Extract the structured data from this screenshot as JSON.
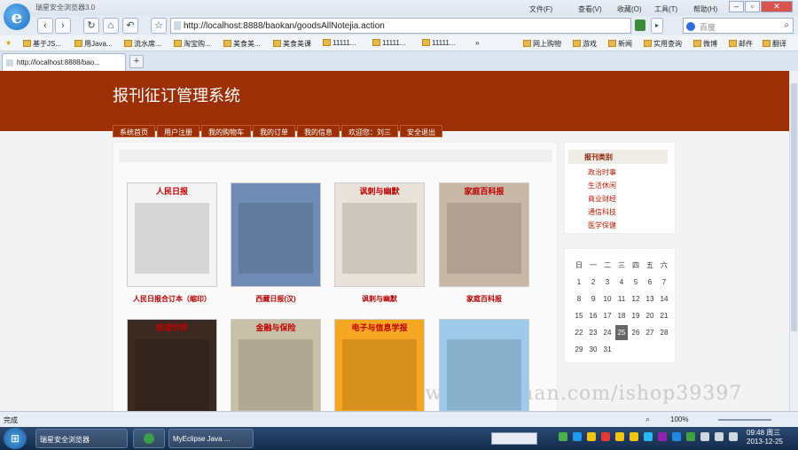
{
  "browser": {
    "app_title": "瑞星安全浏览器3.0",
    "menu": [
      "文件(F)",
      "查看(V)",
      "收藏(O)",
      "工具(T)",
      "帮助(H)"
    ],
    "address": "http://localhost:8888/baokan/goodsAllNotejia.action",
    "search_placeholder": "百度",
    "favorites": [
      "基于JS...",
      "用Java...",
      "流水席...",
      "淘宝购...",
      "美食美...",
      "美食美课",
      "11111...",
      "11111...",
      "11111..."
    ],
    "favorites_right": [
      "网上购物",
      "游戏",
      "新闻",
      "实用查询",
      "微博",
      "邮件",
      "翻译"
    ],
    "tab_label": "http://localhost:8888/bao...",
    "new_tab": "+",
    "status_text": "完成",
    "zoom": "100%"
  },
  "site": {
    "title": "报刊征订管理系统",
    "nav": [
      "系统首页",
      "用户注册",
      "我的购物车",
      "我的订单",
      "我的信息",
      "欢迎您：刘三",
      "安全退出"
    ]
  },
  "goods": [
    {
      "name": "人民日报合订本（缩印）",
      "cover_text": "人民日报",
      "cover_color": "#f4f4f4"
    },
    {
      "name": "西藏日报(汉)",
      "cover_text": "",
      "cover_color": "#6f8db4"
    },
    {
      "name": "讽刺与幽默",
      "cover_text": "讽刺与幽默",
      "cover_color": "#e9e2d8"
    },
    {
      "name": "家庭百科报",
      "cover_text": "家庭百科报",
      "cover_color": "#c9b7a8"
    },
    {
      "name": "",
      "cover_text": "经理世界",
      "cover_color": "#3a2a22"
    },
    {
      "name": "",
      "cover_text": "金融与保险",
      "cover_color": "#c8c0a8"
    },
    {
      "name": "",
      "cover_text": "电子与信息学报",
      "cover_color": "#f5a623"
    },
    {
      "name": "",
      "cover_text": "",
      "cover_color": "#9fc9e8"
    }
  ],
  "sidebar": {
    "category_title": "报刊类别",
    "categories": [
      "政治时事",
      "生活休闲",
      "商业财经",
      "通信科技",
      "医学保健"
    ]
  },
  "calendar": {
    "weekdays": [
      "日",
      "一",
      "二",
      "三",
      "四",
      "五",
      "六"
    ],
    "weeks": [
      [
        "1",
        "2",
        "3",
        "4",
        "5",
        "6",
        "7"
      ],
      [
        "8",
        "9",
        "10",
        "11",
        "12",
        "13",
        "14"
      ],
      [
        "15",
        "16",
        "17",
        "18",
        "19",
        "20",
        "21"
      ],
      [
        "22",
        "23",
        "24",
        "25",
        "26",
        "27",
        "28"
      ],
      [
        "29",
        "30",
        "31",
        "",
        "",
        "",
        ""
      ]
    ],
    "today": "25"
  },
  "watermark": "https://www.huzhan.com/ishop39397",
  "taskbar": {
    "tasks": [
      "瑞星安全浏览器",
      "",
      "MyEclipse Java ..."
    ],
    "time": "09:48 周三",
    "date": "2013-12-25"
  }
}
